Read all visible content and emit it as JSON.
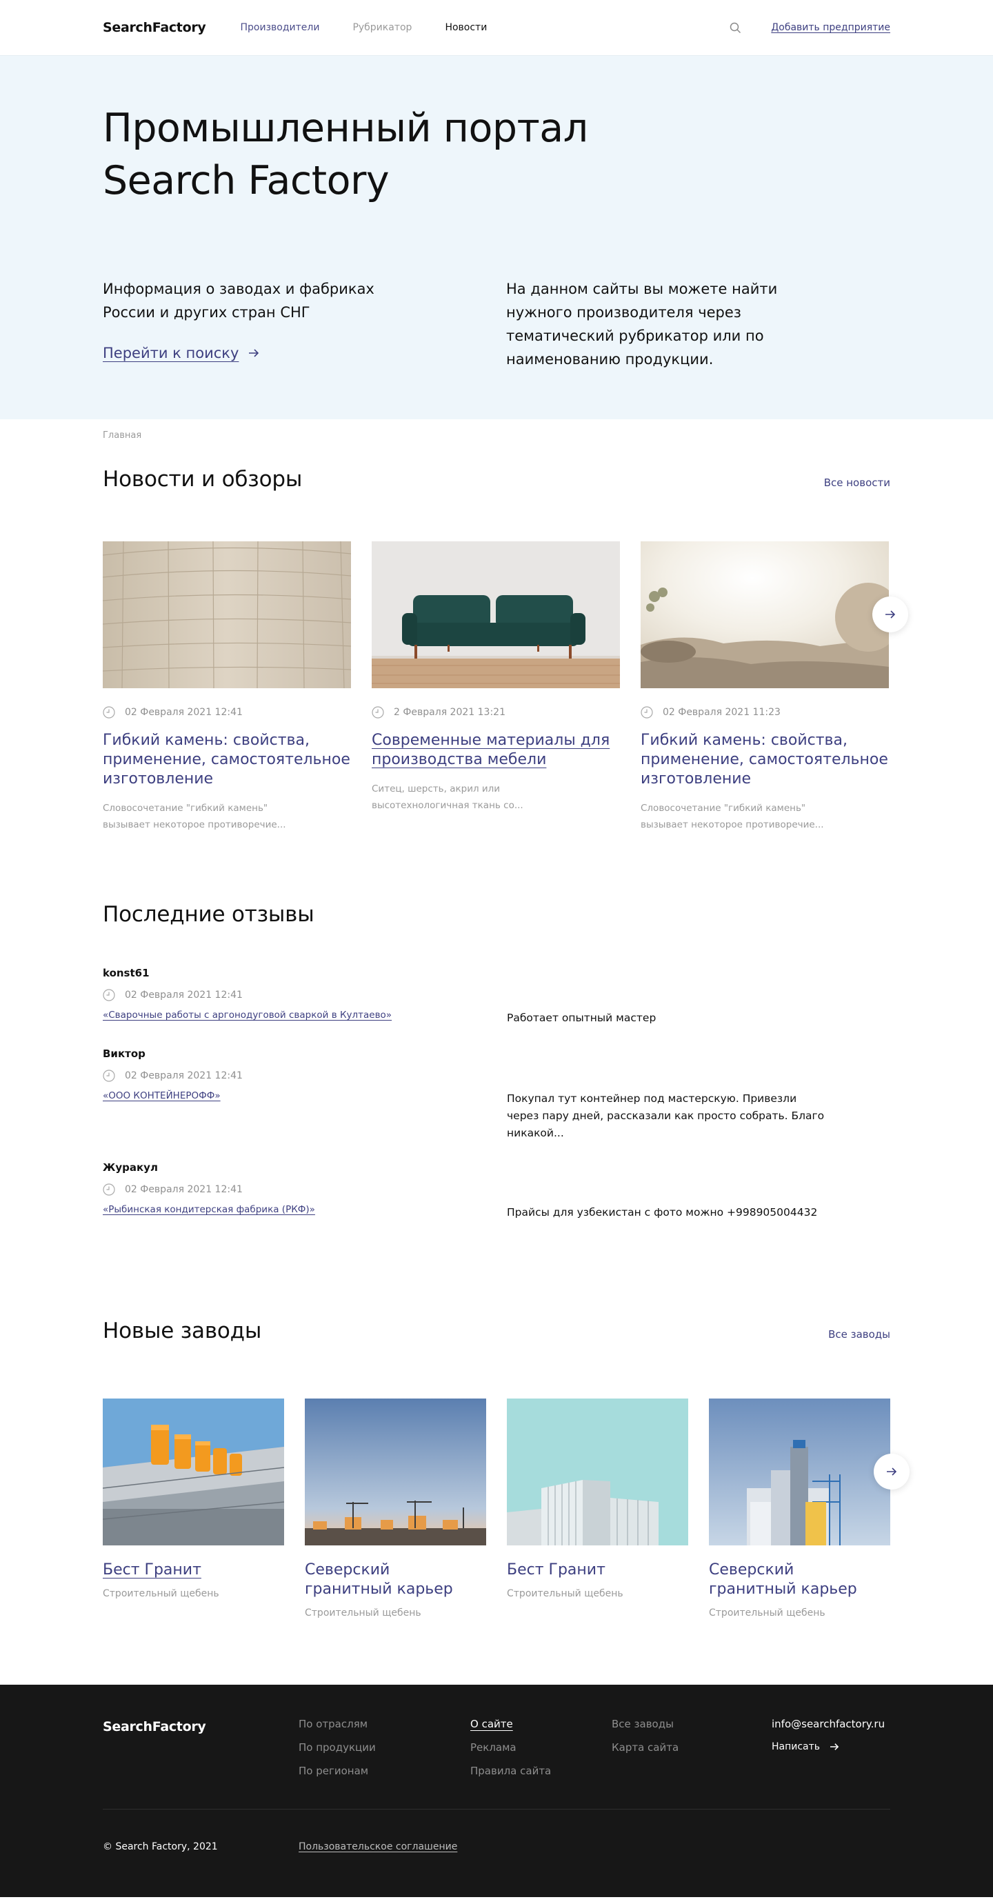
{
  "header": {
    "logo": "SearchFactory",
    "nav": [
      "Производители",
      "Рубрикатор",
      "Новости"
    ],
    "add_link": "Добавить предприятие"
  },
  "hero": {
    "title_line1": "Промышленный портал",
    "title_line2": "Search Factory",
    "left_line1": "Информация о заводах и фабриках",
    "left_line2": "России и других стран СНГ",
    "search_link": "Перейти к поиску",
    "right_line1": "На данном сайты вы можете найти",
    "right_line2": "нужного производителя через",
    "right_line3": "тематический рубрикатор или по",
    "right_line4": "наименованию продукции."
  },
  "breadcrumb": "Главная",
  "news": {
    "title": "Новости и обзоры",
    "all_link": "Все новости",
    "items": [
      {
        "date": "02 Февраля 2021 12:41",
        "title_line1": "Гибкий камень: свойства,",
        "title_line2": "применение, самостоятельное",
        "title_line3": "изготовление",
        "excerpt_line1": "Словосочетание \"гибкий камень\"",
        "excerpt_line2": "вызывает некоторое противоречие..."
      },
      {
        "date": "2 Февраля 2021 13:21",
        "title_line1": "Современные материалы для",
        "title_line2": "производства мебели",
        "excerpt_line1": "Ситец, шерсть, акрил или",
        "excerpt_line2": "высотехнологичная ткань со..."
      },
      {
        "date": "02 Февраля 2021 11:23",
        "title_line1": "Гибкий камень: свойства,",
        "title_line2": "применение, самостоятельное",
        "title_line3": "изготовление",
        "excerpt_line1": "Словосочетание \"гибкий камень\"",
        "excerpt_line2": "вызывает некоторое противоречие..."
      }
    ]
  },
  "reviews": {
    "title": "Последние отзывы",
    "items": [
      {
        "author": "konst61",
        "date": "02 Февраля 2021 12:41",
        "link": "«Сварочные работы с аргонодуговой сваркой в Култаево»",
        "text_line1": "Работает опытный мастер"
      },
      {
        "author": "Виктор",
        "date": "02 Февраля 2021 12:41",
        "link": "«ООО КОНТЕЙНЕРОФФ»",
        "text_line1": "Покупал тут контейнер под мастерскую. Привезли",
        "text_line2": "через пару дней, рассказали как просто собрать. Благо",
        "text_line3": "никакой..."
      },
      {
        "author": "Журакул",
        "date": "02 Февраля 2021 12:41",
        "link": "«Рыбинская кондитерская фабрика (РКФ)»",
        "text_line1": "Прайсы для узбекистан с фото можно +998905004432"
      }
    ]
  },
  "factories": {
    "title": "Новые заводы",
    "all_link": "Все заводы",
    "items": [
      {
        "title_line1": "Бест Гранит",
        "subtitle": "Строительный щебень"
      },
      {
        "title_line1": "Северский",
        "title_line2": "гранитный карьер",
        "subtitle": "Строительный щебень"
      },
      {
        "title_line1": "Бест Гранит",
        "subtitle": "Строительный щебень"
      },
      {
        "title_line1": "Северский",
        "title_line2": "гранитный карьер",
        "subtitle": "Строительный щебень"
      }
    ]
  },
  "footer": {
    "logo": "SearchFactory",
    "col1": [
      "По отраслям",
      "По продукции",
      "По регионам"
    ],
    "col2": [
      "О сайте",
      "Реклама",
      "Правила сайта"
    ],
    "col3": [
      "Все заводы",
      "Карта сайта"
    ],
    "email": "info@searchfactory.ru",
    "write": "Написать",
    "copyright": "© Search Factory, 2021",
    "agreement": "Пользовательское соглашение"
  },
  "icons": {
    "search": "search-icon",
    "clock": "clock-icon",
    "arrow": "arrow-right-icon"
  },
  "colors": {
    "accent": "#3d3f80",
    "hero_bg": "#eef6fb",
    "footer_bg": "#171717"
  }
}
